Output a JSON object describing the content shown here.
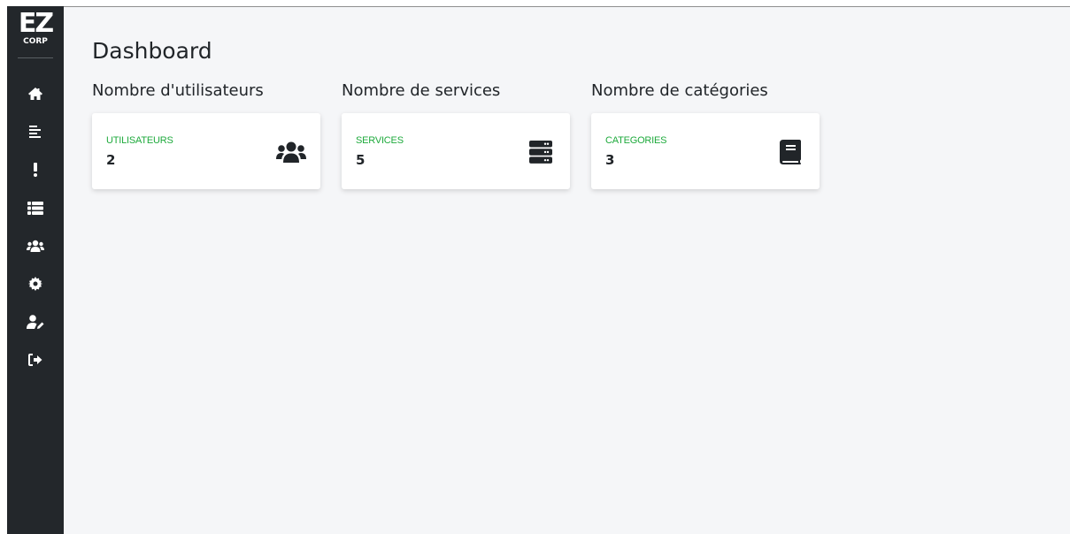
{
  "logo": {
    "top": "EZ",
    "bottom": "CORP"
  },
  "sidebar": {
    "items": [
      {
        "icon": "home-icon"
      },
      {
        "icon": "align-left-icon"
      },
      {
        "icon": "exclamation-icon"
      },
      {
        "icon": "list-icon"
      },
      {
        "icon": "users-icon"
      },
      {
        "icon": "cog-icon"
      },
      {
        "icon": "user-edit-icon"
      },
      {
        "icon": "sign-out-icon"
      }
    ]
  },
  "page": {
    "title": "Dashboard"
  },
  "sections": [
    {
      "label": "Nombre d'utilisateurs",
      "card_label": "UTILISATEURS",
      "value": "2",
      "icon": "users-icon"
    },
    {
      "label": "Nombre de services",
      "card_label": "SERVICES",
      "value": "5",
      "icon": "server-icon"
    },
    {
      "label": "Nombre de catégories",
      "card_label": "CATEGORIES",
      "value": "3",
      "icon": "book-icon"
    }
  ],
  "colors": {
    "sidebar_bg": "#23272b",
    "main_bg": "#f5f6f8",
    "accent": "#1eaa3c",
    "text": "#212529"
  }
}
